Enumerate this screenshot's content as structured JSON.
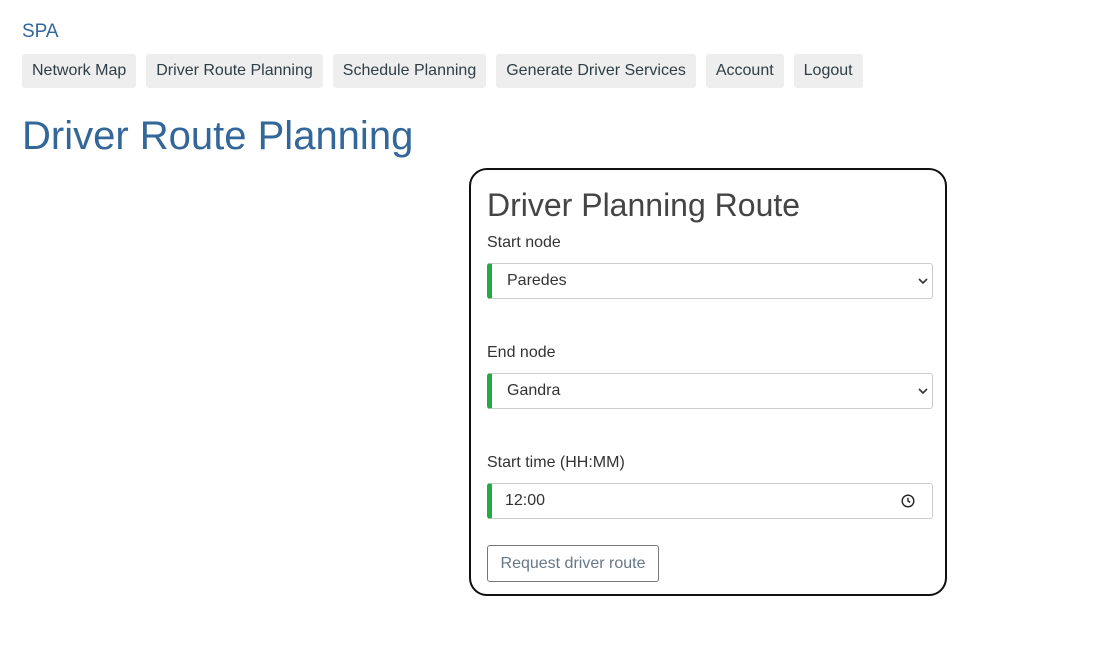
{
  "app": {
    "title": "SPA"
  },
  "nav": {
    "items": [
      {
        "label": "Network Map"
      },
      {
        "label": "Driver Route Planning"
      },
      {
        "label": "Schedule Planning"
      },
      {
        "label": "Generate Driver Services"
      },
      {
        "label": "Account"
      },
      {
        "label": "Logout"
      }
    ]
  },
  "page": {
    "title": "Driver Route Planning"
  },
  "form": {
    "title": "Driver Planning Route",
    "start_node": {
      "label": "Start node",
      "value": "Paredes"
    },
    "end_node": {
      "label": "End node",
      "value": "Gandra"
    },
    "start_time": {
      "label": "Start time (HH:MM)",
      "value": "12:00"
    },
    "submit_label": "Request driver route"
  },
  "colors": {
    "link": "#336699",
    "valid_border": "#22aa44",
    "nav_bg": "#eeeeee"
  },
  "icons": {
    "select": "chevron-down-icon",
    "time": "clock-icon"
  }
}
